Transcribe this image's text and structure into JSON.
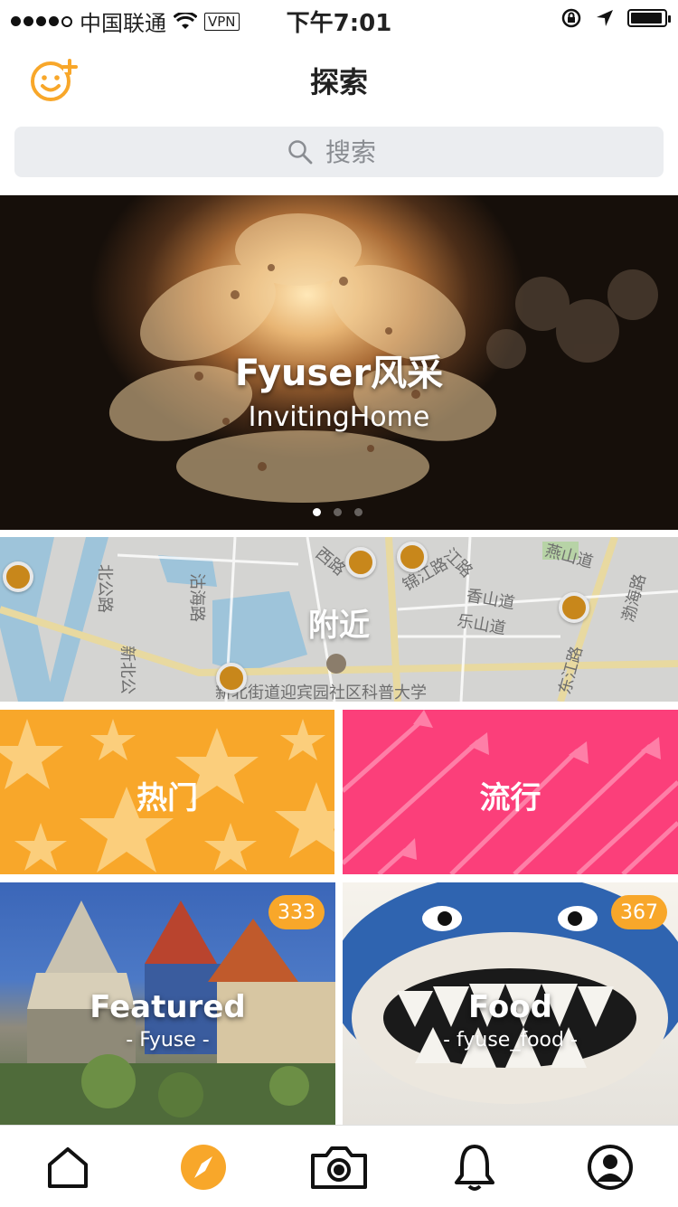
{
  "status_bar": {
    "carrier": "中国联通",
    "vpn": "VPN",
    "time": "下午7:01"
  },
  "header": {
    "title": "探索",
    "left_icon": "smiley-add-icon"
  },
  "search": {
    "placeholder": "搜索",
    "icon": "search-icon"
  },
  "banner": {
    "title": "Fyuser风采",
    "subtitle": "InvitingHome",
    "pages": 3,
    "active_page": 1
  },
  "nearby": {
    "label": "附近",
    "map_labels": [
      "北公路",
      "西路",
      "锦江路",
      "江路",
      "燕山道",
      "沽海路",
      "香山道",
      "乐山道",
      "新北公",
      "渤海路",
      "东江路",
      "新北街道迎宾园社区科普大学"
    ]
  },
  "categories": {
    "hot": {
      "label": "热门",
      "color": "#f8a72a"
    },
    "trending": {
      "label": "流行",
      "color": "#fb3f7a"
    }
  },
  "collections": [
    {
      "title": "Featured",
      "subtitle": "- Fyuse -",
      "count": "333"
    },
    {
      "title": "Food",
      "subtitle": "- fyuse_food -",
      "count": "367"
    }
  ],
  "tab_bar": {
    "items": [
      "home-icon",
      "explore-compass-icon",
      "camera-icon",
      "bell-icon",
      "profile-icon"
    ],
    "active": "explore-compass-icon",
    "accent": "#f8a72a"
  }
}
